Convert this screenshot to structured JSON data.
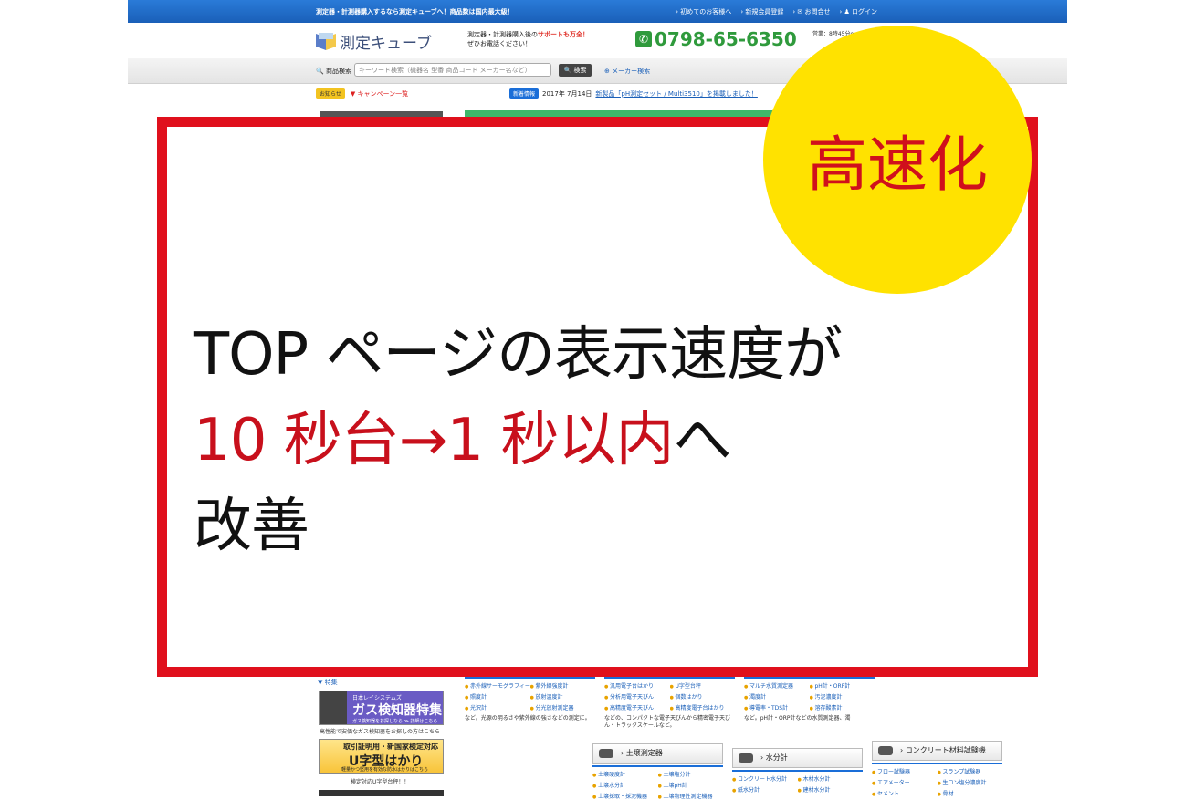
{
  "topbar": {
    "tagline": "測定器・計測器購入するなら測定キューブへ！商品数は国内最大級！",
    "links": [
      "› 初めてのお客様へ",
      "› 新規会員登録",
      "› ✉ お問合せ",
      "› ♟ ログイン"
    ]
  },
  "header": {
    "logo_text": "測定キューブ",
    "support_line1": "測定器・計測器購入後の",
    "support_highlight": "サポートも万全！",
    "support_line2": "ぜひお電話ください！",
    "phone": "0798-65-6350",
    "hours": "営業：8時45分〜"
  },
  "search": {
    "label": "商品検索",
    "placeholder": "キーワード検索（機器名 型番 商品コード メーカー名など）",
    "button": "検索",
    "maker_link": "メーカー検索"
  },
  "notices": {
    "info_badge": "お知らせ",
    "campaign": "▼ キャンペーン一覧",
    "news_badge": "新着情報",
    "news_date": "2017年 7月14日",
    "news_text": "新製品「pH測定セット / Multi3510」を掲載しました！"
  },
  "overlay": {
    "badge": "高速化",
    "line1": "TOP ページの表示速度が",
    "line2_red": "10 秒台→1 秒以内",
    "line2_black": "へ",
    "line3": "改善"
  },
  "sidebar": {
    "title": "▼ 特集",
    "banner1_small": "日本レイシステムズ",
    "banner1_big": "ガス検知器特集",
    "banner1_sub": "ガス検知器をお探しなら ≫ 詳細はこちら",
    "caption1": "高性能で安価なガス検知器をお探しの方はこちら",
    "banner2_t1": "取引証明用・新国家検定対応",
    "banner2_t2": "U字型はかり",
    "banner2_t3": "軽量かつ堅用を有効な防水はかりはこちら",
    "caption2": "検定対応U字型台秤！！"
  },
  "columns": {
    "col1": {
      "items": [
        "赤外線サーモグラフィー",
        "紫外線強度計",
        "照度計",
        "放射温度計",
        "光沢計",
        "分光放射測定器"
      ],
      "desc": "など。光源の明るさや紫外線の強さなどの測定に。",
      "head2": "土壌測定器",
      "items2": [
        "土壌硬度計",
        "土壌塩分計",
        "土壌水分計",
        "土壌pH計",
        "土壌採取・採泥機器",
        "土壌物理性測定機器"
      ]
    },
    "col2": {
      "items": [
        "汎用電子台はかり",
        "U字型台秤",
        "分析用電子天びん",
        "個数はかり",
        "高精度電子天びん",
        "高精度電子台はかり"
      ],
      "desc": "などの、コンパクトな電子天びんから精密電子天びん・トラックスケールなど。",
      "head2": "水分計",
      "items2": [
        "コンクリート水分計",
        "木材水分計",
        "紙水分計",
        "建材水分計"
      ]
    },
    "col3": {
      "items": [
        "マルチ水質測定器",
        "pH計・ORP計",
        "濁度計",
        "汚泥濃度計",
        "導電率・TDS計",
        "溶存酸素計"
      ],
      "desc": "など。pH計・ORP計などの水質測定器、濁",
      "head2": "コンクリート材料試験機",
      "items2": [
        "フロー試験器",
        "スランプ試験器",
        "エアメーター",
        "生コン塩分濃度計",
        "セメント",
        "骨材"
      ]
    }
  }
}
